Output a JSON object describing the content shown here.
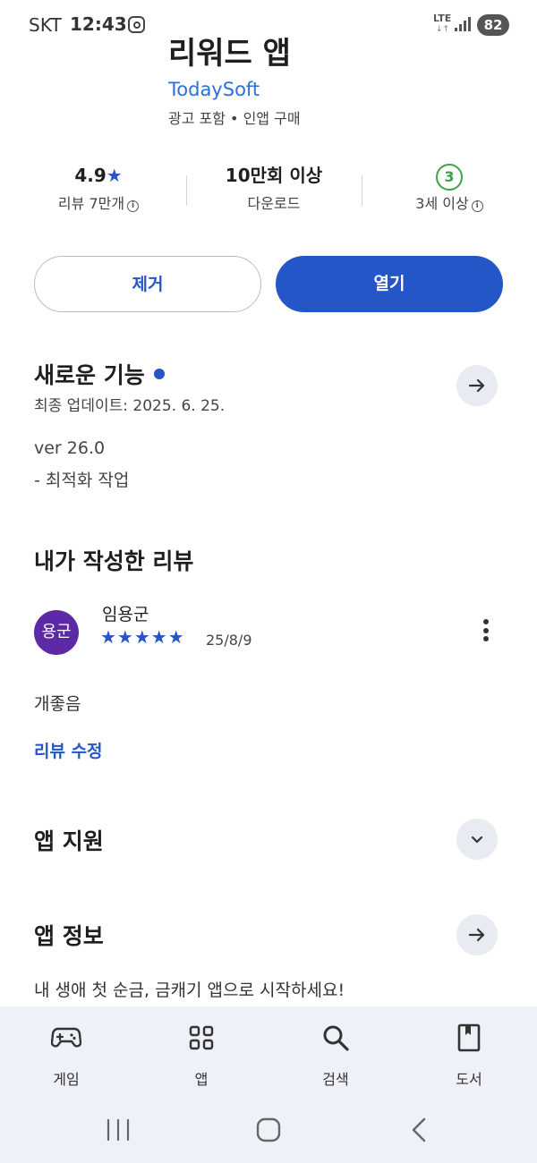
{
  "status_bar": {
    "carrier": "SKT",
    "time": "12:43",
    "network": "LTE",
    "battery": "82"
  },
  "app": {
    "title": "리워드 앱",
    "developer": "TodaySoft",
    "ads_in_app": "광고 포함 • 인앱 구매"
  },
  "stats": {
    "rating_value": "4.9",
    "rating_label": "리뷰 7만개",
    "downloads_value": "10만회 이상",
    "downloads_label": "다운로드",
    "age_badge": "3",
    "age_label": "3세 이상"
  },
  "actions": {
    "remove_label": "제거",
    "open_label": "열기"
  },
  "whats_new": {
    "title": "새로운 기능",
    "updated": "최종 업데이트: 2025. 6. 25.",
    "version": "ver 26.0",
    "note": "- 최적화 작업"
  },
  "my_review": {
    "title": "내가 작성한 리뷰",
    "avatar_text": "용군",
    "reviewer": "임용군",
    "stars": "★★★★★",
    "rating": 5,
    "date": "25/8/9",
    "text": "개좋음",
    "edit_label": "리뷰 수정"
  },
  "app_support": {
    "title": "앱 지원"
  },
  "app_info": {
    "title": "앱 정보",
    "description": "내 생애 첫 순금, 금캐기 앱으로 시작하세요!"
  },
  "bottom_nav": {
    "items": [
      {
        "label": "게임",
        "icon": "gamepad-icon"
      },
      {
        "label": "앱",
        "icon": "apps-grid-icon"
      },
      {
        "label": "검색",
        "icon": "search-icon"
      },
      {
        "label": "도서",
        "icon": "book-icon"
      }
    ]
  }
}
